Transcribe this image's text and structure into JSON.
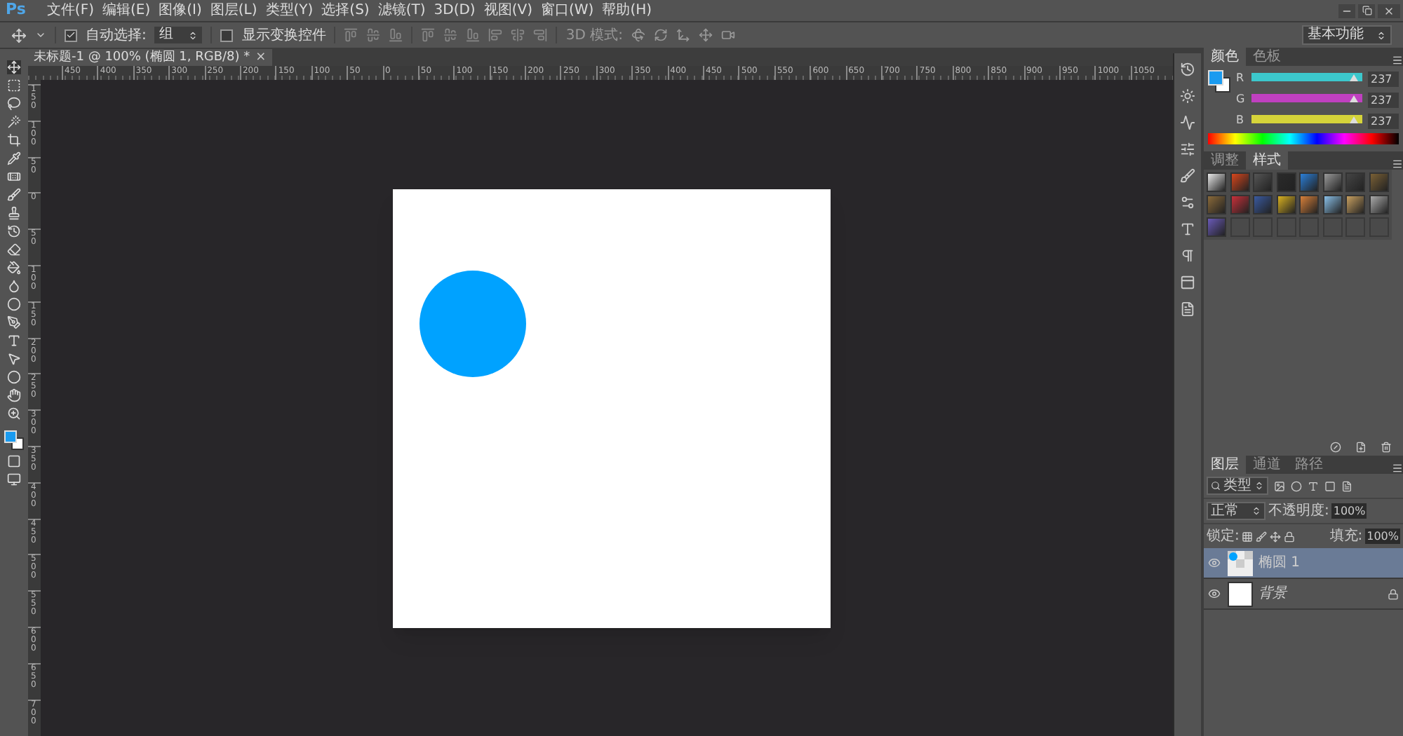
{
  "app_logo": "Ps",
  "menu": [
    "文件(F)",
    "编辑(E)",
    "图像(I)",
    "图层(L)",
    "类型(Y)",
    "选择(S)",
    "滤镜(T)",
    "3D(D)",
    "视图(V)",
    "窗口(W)",
    "帮助(H)"
  ],
  "options_bar": {
    "auto_select": {
      "label": "自动选择:",
      "checked": true
    },
    "auto_select_target": "组",
    "show_transform": {
      "label": "显示变换控件",
      "checked": false
    },
    "mode_label": "3D 模式:",
    "workspace": "基本功能"
  },
  "document_tab": {
    "title": "未标题-1 @ 100% (椭圆 1, RGB/8) *",
    "close": "×"
  },
  "rulers": {
    "horizontal": [
      "450",
      "400",
      "350",
      "300",
      "250",
      "200",
      "150",
      "100",
      "50",
      "0",
      "50",
      "100",
      "150",
      "200",
      "250",
      "300",
      "350",
      "400",
      "450",
      "500",
      "550",
      "600",
      "650",
      "700",
      "750",
      "800",
      "850",
      "900",
      "950",
      "1000",
      "1050"
    ],
    "vertical": [
      "150",
      "100",
      "50",
      "0",
      "50",
      "100",
      "150",
      "200",
      "250",
      "300",
      "350",
      "400",
      "450",
      "500",
      "550",
      "600",
      "650",
      "700"
    ]
  },
  "color_panel": {
    "tabs": [
      {
        "label": "颜色",
        "selected": true
      },
      {
        "label": "色板",
        "selected": false
      }
    ],
    "channels": [
      {
        "name": "R",
        "level": 0.93,
        "value": "237",
        "color": "#3cc8cc"
      },
      {
        "name": "G",
        "level": 0.93,
        "value": "237",
        "color": "#c040c0"
      },
      {
        "name": "B",
        "level": 0.93,
        "value": "237",
        "color": "#d6d43a"
      }
    ]
  },
  "styles_panel": {
    "tabs": [
      {
        "label": "调整",
        "selected": false
      },
      {
        "label": "样式",
        "selected": true
      }
    ]
  },
  "layers_panel": {
    "tabs": [
      {
        "label": "图层",
        "selected": true
      },
      {
        "label": "通道",
        "selected": false
      },
      {
        "label": "路径",
        "selected": false
      }
    ],
    "filter": "类型",
    "blend_mode": "正常",
    "opacity_label": "不透明度:",
    "opacity": "100%",
    "lock_label": "锁定:",
    "fill_label": "填充:",
    "fill": "100%",
    "layers": [
      {
        "name": "椭圆 1",
        "kind": "shape",
        "visible": true,
        "selected": true,
        "locked": false
      },
      {
        "name": "背景",
        "kind": "background",
        "visible": true,
        "selected": false,
        "locked": true
      }
    ]
  }
}
